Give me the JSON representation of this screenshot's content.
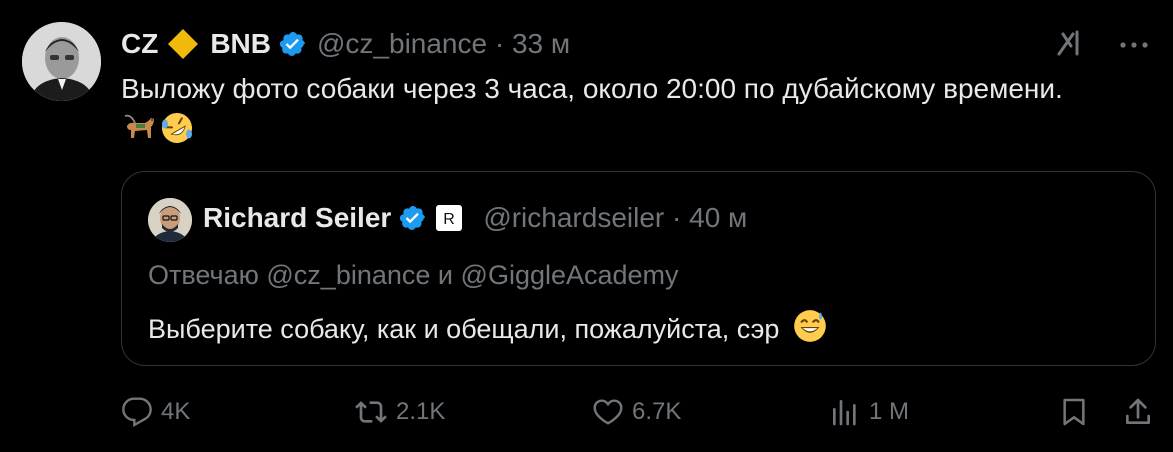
{
  "author": {
    "name": "CZ",
    "affiliate": "BNB",
    "handle": "@cz_binance",
    "time": "33 м"
  },
  "tweet": {
    "text": "Выложу фото собаки через 3 часа, около 20:00 по дубайскому времени.",
    "emojis": [
      "guide-dog-emoji",
      "rofl-emoji"
    ]
  },
  "quote": {
    "name": "Richard Seiler",
    "affiliate_logo": "R",
    "handle": "@richardseiler",
    "time": "40 м",
    "reply_prefix": "Отвечаю",
    "reply_user1": "@cz_binance",
    "reply_and": "и",
    "reply_user2": "@GiggleAcademy",
    "text": "Выберите собаку, как и обещали, пожалуйста, сэр"
  },
  "metrics": {
    "replies": "4K",
    "reposts": "2.1K",
    "likes": "6.7K",
    "views": "1 М"
  },
  "colors": {
    "background": "#000000",
    "text": "#e7e9ea",
    "muted": "#71767b",
    "verified": "#1d9bf0",
    "bnb": "#f0b90b",
    "border": "#2f3336"
  }
}
